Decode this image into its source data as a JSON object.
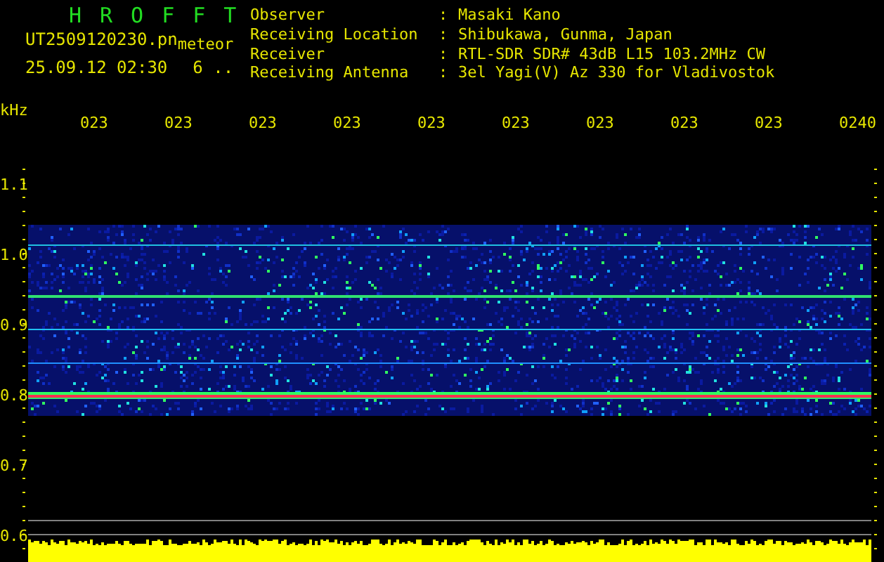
{
  "title": "HROFFT",
  "file_name": "UT2509120230.pn",
  "file_suffix": "meteor",
  "datetime": "25.09.12 02:30",
  "count": "6 ..",
  "info": [
    {
      "label": "Observer",
      "separator": ":",
      "value": "Masaki Kano"
    },
    {
      "label": "Receiving Location",
      "separator": ":",
      "value": "Shibukawa, Gunma, Japan"
    },
    {
      "label": "Receiver",
      "separator": ":",
      "value": "RTL-SDR SDR# 43dB L15 103.2MHz CW"
    },
    {
      "label": "Receiving Antenna",
      "separator": ":",
      "value": "3el Yagi(V) Az 330 for Vladivostok"
    }
  ],
  "frequency_axis": {
    "unit": "kHz",
    "ticks": [
      "1.1",
      "1.0",
      "0.9",
      "0.8",
      "0.7",
      "0.6"
    ]
  },
  "time_axis": {
    "ticks": [
      "023",
      "023",
      "023",
      "023",
      "023",
      "023",
      "023",
      "023",
      "023",
      "0240"
    ]
  }
}
